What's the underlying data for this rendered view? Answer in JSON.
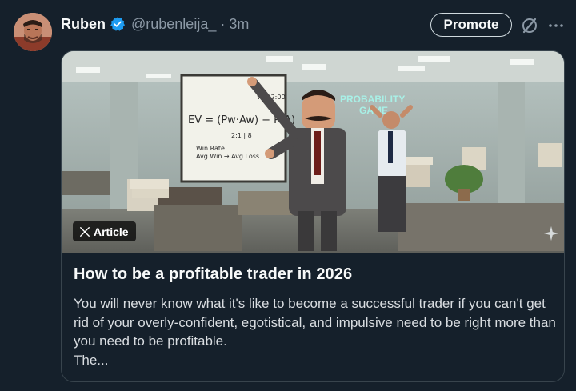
{
  "author": {
    "display_name": "Ruben",
    "handle": "@rubenleija_",
    "separator": "·",
    "timestamp": "3m",
    "verified": true
  },
  "actions": {
    "promote_label": "Promote",
    "grok_icon": "grok-icon",
    "more_icon": "more-icon"
  },
  "article": {
    "badge_label": "Article",
    "title": "How to be a profitable trader in 2026",
    "description": "You will never know what it's like to become a successful trader if you can't get rid of your overly-confident, egotistical, and impulsive need to be right more than you need to be profitable.",
    "continuation": "The...",
    "image": {
      "whiteboard_formula": "EV = (Pw · Aw) − P(1 − Pw) · AL",
      "whiteboard_note": "Win 2:00",
      "whiteboard_lines": [
        "2:1 | 8",
        "Win Rate",
        "Avg Win → Avg Loss"
      ],
      "neon_sign": [
        "PROBABILITY",
        "GAME"
      ]
    }
  },
  "colors": {
    "background": "#15202b",
    "text": "#f7f9f9",
    "muted": "#8b98a5",
    "border": "#38444d",
    "verified": "#1d9bf0"
  }
}
